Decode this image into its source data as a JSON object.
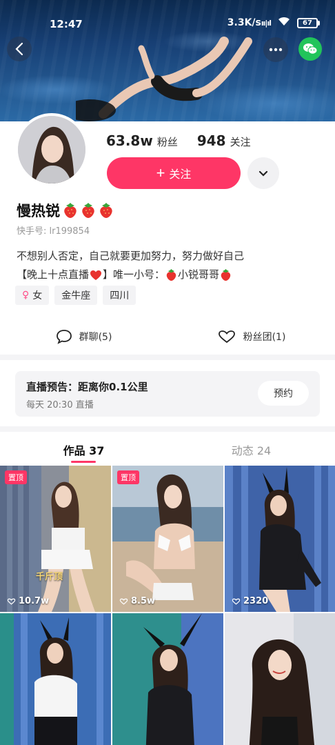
{
  "status_bar": {
    "time": "12:47",
    "network_speed": "3.3K/s",
    "battery": "67"
  },
  "header": {
    "back_icon": "chevron-left-icon",
    "more_icon": "more-dots-icon",
    "share_icon": "wechat-icon"
  },
  "profile": {
    "followers_count": "63.8w",
    "followers_label": "粉丝",
    "following_count": "948",
    "following_label": "关注",
    "follow_button_label": "关注",
    "name": "慢热锐",
    "user_id": "快手号: lr199854",
    "bio_line1": "不想别人否定，自己就要更加努力，努力做好自己",
    "bio_line2_a": "【晚上十点直播",
    "bio_line2_b": "】唯一小号：",
    "bio_line2_c": "小锐哥哥",
    "tags": [
      "女",
      "金牛座",
      "四川"
    ],
    "group_chat": "群聊(5)",
    "fan_club": "粉丝团(1)"
  },
  "live_preview": {
    "title": "直播预告：距离你0.1公里",
    "schedule": "每天 20:30 直播",
    "reserve_label": "预约"
  },
  "tabs": [
    {
      "label": "作品 37",
      "active": true
    },
    {
      "label": "动态 24",
      "active": false
    }
  ],
  "works": [
    {
      "pinned_label": "置顶",
      "likes": "10.7w",
      "watermark": "千斤顶"
    },
    {
      "pinned_label": "置顶",
      "likes": "8.5w"
    },
    {
      "likes": "2320"
    }
  ],
  "colors": {
    "accent": "#fe3666",
    "wechat": "#21c45a",
    "panel_bg": "#f4f4f6"
  }
}
